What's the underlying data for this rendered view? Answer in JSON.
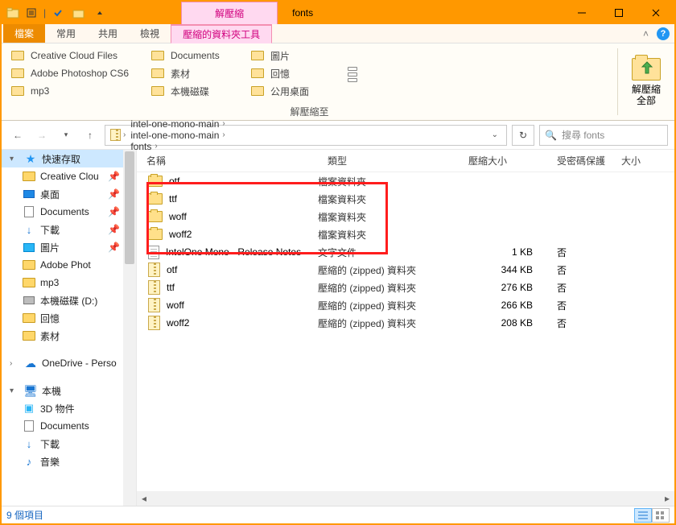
{
  "titlebar": {
    "context_tab": "解壓縮",
    "title": "fonts"
  },
  "ribbon_tabs": {
    "file": "檔案",
    "home": "常用",
    "share": "共用",
    "view": "檢視",
    "extract": "壓縮的資料夾工具"
  },
  "ribbon": {
    "destinations": [
      "Creative Cloud Files",
      "Documents",
      "圖片",
      "Adobe Photoshop CS6",
      "素材",
      "回憶",
      "mp3",
      "本機磁碟",
      "公用桌面"
    ],
    "group_label": "解壓縮至",
    "extract_all": "解壓縮\n全部"
  },
  "breadcrumb": [
    "intel-one-mono-main",
    "intel-one-mono-main",
    "fonts"
  ],
  "search_placeholder": "搜尋 fonts",
  "sidebar": {
    "quick_access": "快速存取",
    "items": [
      {
        "label": "Creative Clou",
        "icon": "folder",
        "pin": true
      },
      {
        "label": "桌面",
        "icon": "desktop",
        "pin": true
      },
      {
        "label": "Documents",
        "icon": "doc",
        "pin": true
      },
      {
        "label": "下載",
        "icon": "dl",
        "pin": true
      },
      {
        "label": "圖片",
        "icon": "pic",
        "pin": true
      },
      {
        "label": "Adobe Phot",
        "icon": "folder",
        "pin": false
      },
      {
        "label": "mp3",
        "icon": "folder",
        "pin": false
      },
      {
        "label": "本機磁碟 (D:)",
        "icon": "drive",
        "pin": false
      },
      {
        "label": "回憶",
        "icon": "folder",
        "pin": false
      },
      {
        "label": "素材",
        "icon": "folder",
        "pin": false
      }
    ],
    "onedrive": "OneDrive - Perso",
    "this_pc": "本機",
    "pc_items": [
      {
        "label": "3D 物件",
        "icon": "3d"
      },
      {
        "label": "Documents",
        "icon": "doc"
      },
      {
        "label": "下載",
        "icon": "dl"
      },
      {
        "label": "音樂",
        "icon": "music"
      }
    ]
  },
  "columns": {
    "name": "名稱",
    "type": "類型",
    "zsize": "壓縮大小",
    "pwd": "受密碼保護",
    "size": "大小"
  },
  "files": [
    {
      "name": "otf",
      "type": "檔案資料夾",
      "zsize": "",
      "pwd": "",
      "icon": "folder"
    },
    {
      "name": "ttf",
      "type": "檔案資料夾",
      "zsize": "",
      "pwd": "",
      "icon": "folder"
    },
    {
      "name": "woff",
      "type": "檔案資料夾",
      "zsize": "",
      "pwd": "",
      "icon": "folder"
    },
    {
      "name": "woff2",
      "type": "檔案資料夾",
      "zsize": "",
      "pwd": "",
      "icon": "folder"
    },
    {
      "name": "IntelOne Mono - Release Notes",
      "type": "文字文件",
      "zsize": "1 KB",
      "pwd": "否",
      "icon": "txt"
    },
    {
      "name": "otf",
      "type": "壓縮的 (zipped) 資料夾",
      "zsize": "344 KB",
      "pwd": "否",
      "icon": "zip"
    },
    {
      "name": "ttf",
      "type": "壓縮的 (zipped) 資料夾",
      "zsize": "276 KB",
      "pwd": "否",
      "icon": "zip"
    },
    {
      "name": "woff",
      "type": "壓縮的 (zipped) 資料夾",
      "zsize": "266 KB",
      "pwd": "否",
      "icon": "zip"
    },
    {
      "name": "woff2",
      "type": "壓縮的 (zipped) 資料夾",
      "zsize": "208 KB",
      "pwd": "否",
      "icon": "zip"
    }
  ],
  "status": "9 個項目"
}
